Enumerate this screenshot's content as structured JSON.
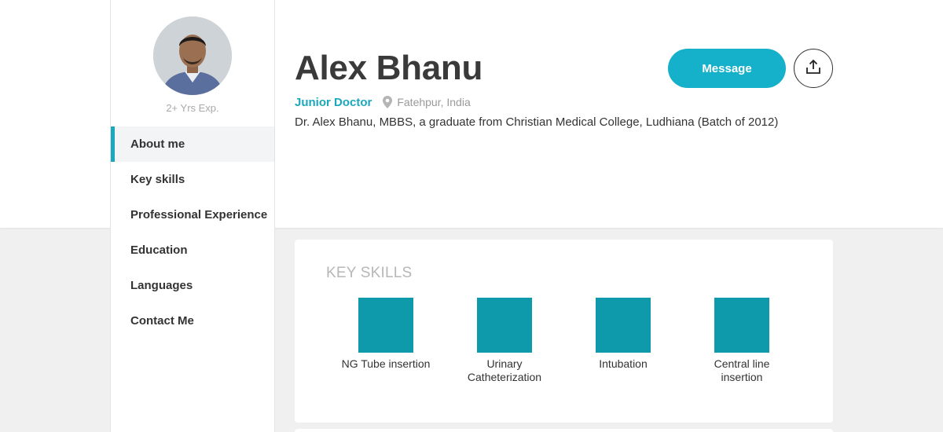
{
  "profile": {
    "experience": "2+ Yrs Exp.",
    "name": "Alex Bhanu",
    "role": "Junior Doctor",
    "location": "Fatehpur, India",
    "bio": "Dr. Alex Bhanu, MBBS, a graduate from Christian Medical College, Ludhiana (Batch of 2012)"
  },
  "nav": {
    "items": [
      {
        "label": "About me",
        "active": true
      },
      {
        "label": "Key skills"
      },
      {
        "label": "Professional Experience"
      },
      {
        "label": "Education"
      },
      {
        "label": "Languages"
      },
      {
        "label": "Contact Me"
      }
    ]
  },
  "actions": {
    "message_label": "Message",
    "share_icon": "share-upload-icon"
  },
  "skills_section": {
    "title": "KEY SKILLS",
    "skills": [
      {
        "line1": "NG Tube insertion",
        "line2": ""
      },
      {
        "line1": "Urinary",
        "line2": "Catheterization"
      },
      {
        "line1": "Intubation",
        "line2": ""
      },
      {
        "line1": "Central line",
        "line2": "insertion"
      }
    ]
  },
  "colors": {
    "accent": "#1ba7bc",
    "button": "#15b0c9",
    "skill_tile": "#0f9aac",
    "background": "#f0f0f0"
  }
}
